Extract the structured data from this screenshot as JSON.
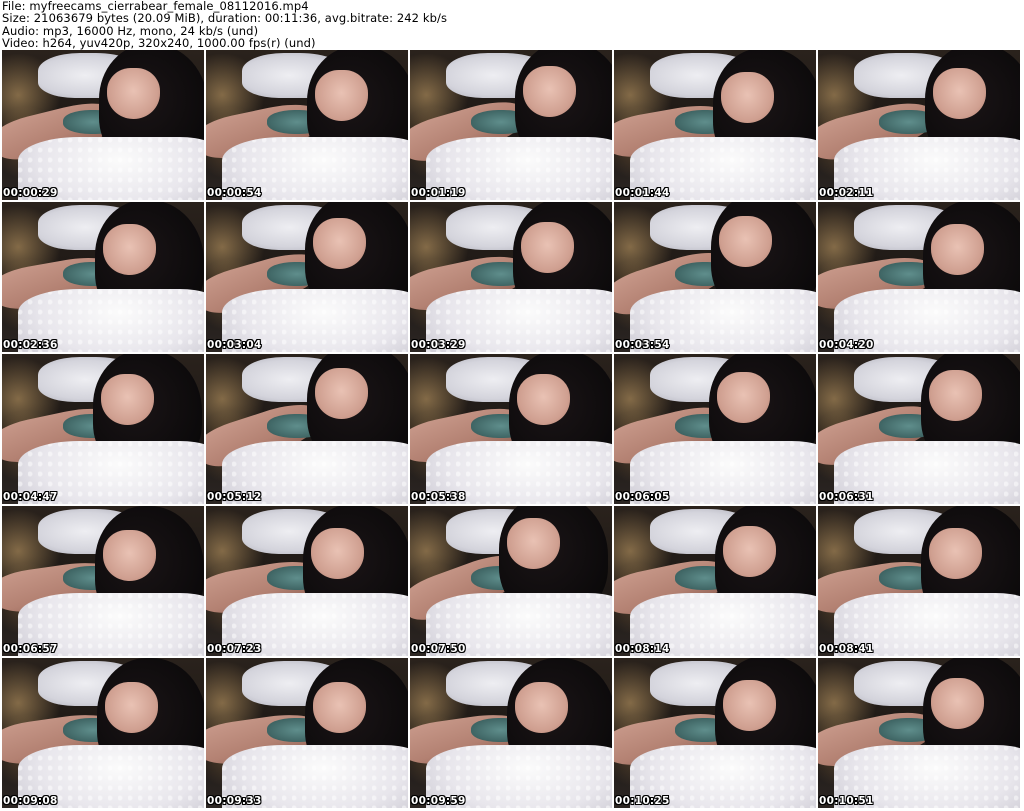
{
  "header": {
    "file_line": "File: myfreecams_cierrabear_female_08112016.mp4",
    "size_line": "Size: 21063679 bytes (20.09 MiB), duration: 00:11:36, avg.bitrate: 242 kb/s",
    "audio_line": "Audio: mp3, 16000 Hz, mono, 24 kb/s (und)",
    "video_line": "Video: h264, yuv420p, 320x240, 1000.00 fps(r) (und)"
  },
  "thumbnails": [
    {
      "timestamp": "00:00:29"
    },
    {
      "timestamp": "00:00:54"
    },
    {
      "timestamp": "00:01:19"
    },
    {
      "timestamp": "00:01:44"
    },
    {
      "timestamp": "00:02:11"
    },
    {
      "timestamp": "00:02:36"
    },
    {
      "timestamp": "00:03:04"
    },
    {
      "timestamp": "00:03:29"
    },
    {
      "timestamp": "00:03:54"
    },
    {
      "timestamp": "00:04:20"
    },
    {
      "timestamp": "00:04:47"
    },
    {
      "timestamp": "00:05:12"
    },
    {
      "timestamp": "00:05:38"
    },
    {
      "timestamp": "00:06:05"
    },
    {
      "timestamp": "00:06:31"
    },
    {
      "timestamp": "00:06:57"
    },
    {
      "timestamp": "00:07:23"
    },
    {
      "timestamp": "00:07:50"
    },
    {
      "timestamp": "00:08:14"
    },
    {
      "timestamp": "00:08:41"
    },
    {
      "timestamp": "00:09:08"
    },
    {
      "timestamp": "00:09:33"
    },
    {
      "timestamp": "00:09:59"
    },
    {
      "timestamp": "00:10:25"
    },
    {
      "timestamp": "00:10:51"
    }
  ]
}
